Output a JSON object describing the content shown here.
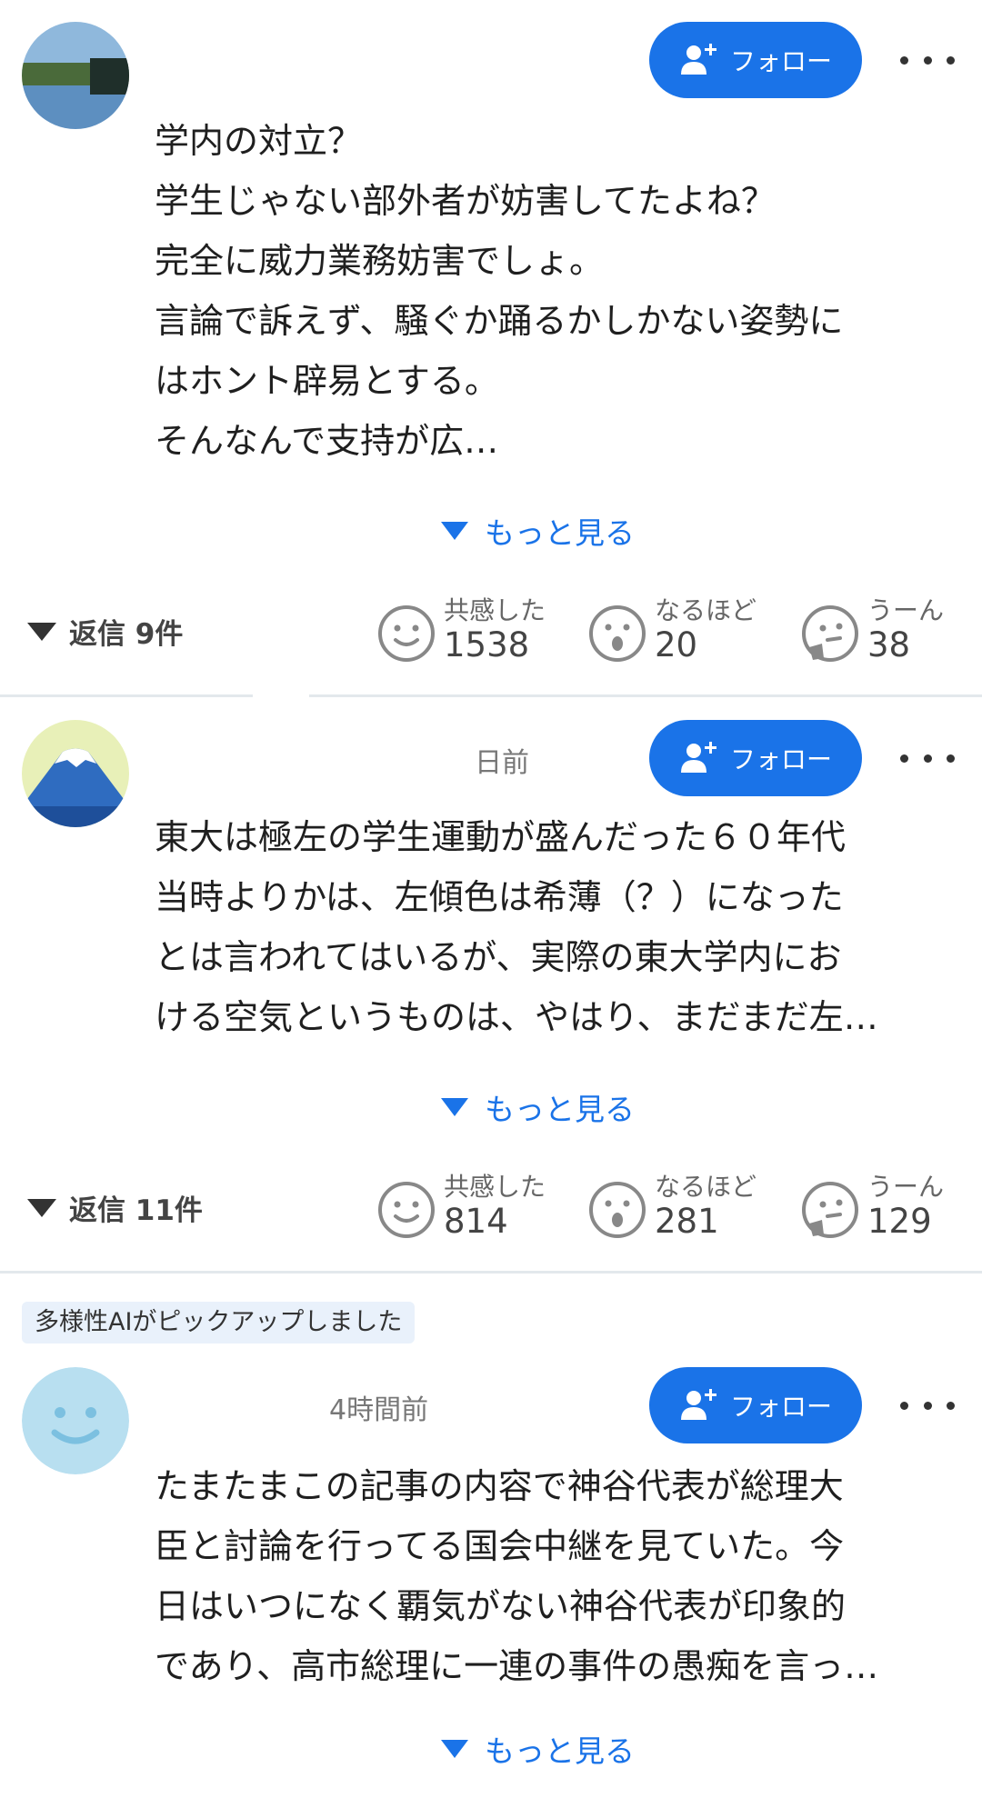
{
  "follow_label": "フォロー",
  "read_more_label": "もっと見る",
  "comments": [
    {
      "timestamp": "",
      "lines": [
        "学内の対立？",
        "学生じゃない部外者が妨害してたよね？",
        "完全に威力業務妨害でしょ。",
        "言論で訴えず、騒ぐか踊るかしかない姿勢に",
        "はホント辟易とする。",
        "そんなんで支持が広…"
      ],
      "replies": "返信 9件",
      "reactions": [
        {
          "label": "共感した",
          "count": "1538",
          "icon": "smile-face-icon"
        },
        {
          "label": "なるほど",
          "count": "20",
          "icon": "surprised-face-icon"
        },
        {
          "label": "うーん",
          "count": "38",
          "icon": "thinking-face-icon"
        }
      ]
    },
    {
      "timestamp": "日前",
      "lines": [
        "東大は極左の学生運動が盛んだった６０年代",
        "当時よりかは、左傾色は希薄（？）になった",
        "とは言われてはいるが、実際の東大学内にお",
        "ける空気というものは、やはり、まだまだ左…"
      ],
      "replies": "返信 11件",
      "reactions": [
        {
          "label": "共感した",
          "count": "814",
          "icon": "smile-face-icon"
        },
        {
          "label": "なるほど",
          "count": "281",
          "icon": "surprised-face-icon"
        },
        {
          "label": "うーん",
          "count": "129",
          "icon": "thinking-face-icon"
        }
      ]
    },
    {
      "badge": "多様性AIがピックアップしました",
      "timestamp": "4時間前",
      "lines": [
        "たまたまこの記事の内容で神谷代表が総理大",
        "臣と討論を行ってる国会中継を見ていた。今",
        "日はいつになく覇気がない神谷代表が印象的",
        "であり、高市総理に一連の事件の愚痴を言っ…"
      ]
    }
  ],
  "colors": {
    "accent": "#1a73e8",
    "badge_bg": "#e9f1fb"
  }
}
